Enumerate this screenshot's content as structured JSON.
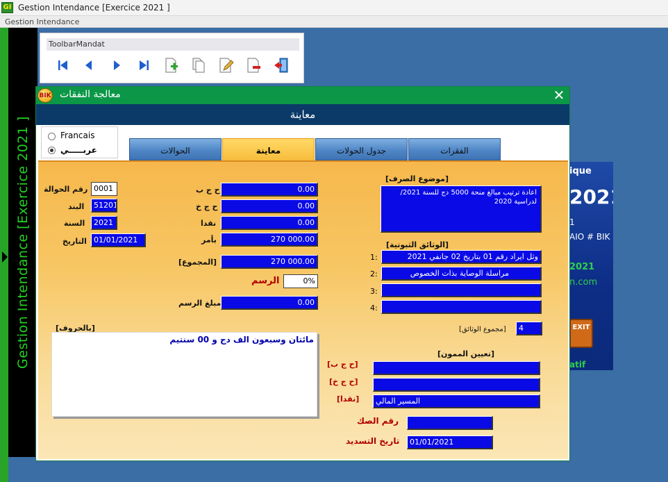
{
  "window": {
    "title": "Gestion Intendance [Exercice  2021 ]",
    "icon": "GI"
  },
  "menubar": {
    "item": "Gestion Intendance"
  },
  "sidebar": {
    "text": "Gestion Intendance [Exercice  2021 ]"
  },
  "toolbar": {
    "title": "ToolbarMandat",
    "buttons": [
      "first-icon",
      "prev-icon",
      "next-icon",
      "last-icon",
      "add-record-icon",
      "copy-record-icon",
      "edit-record-icon",
      "delete-record-icon",
      "exit-door-icon"
    ]
  },
  "background_banner": {
    "text1": "ique",
    "year": "2021",
    "line3": "1",
    "line4": "AIO # BIK",
    "green_year": "2021",
    "site": "n.com",
    "exit": "EXIT",
    "version": "atif Version"
  },
  "dialog": {
    "title": "معالجة النفقات",
    "logo": "BIK",
    "header": "معاينة",
    "language": {
      "option1": "Francais",
      "option2": "عربـــــي",
      "selected": "عربـــــي"
    },
    "tabs": [
      "الفقرات",
      "جدول الحولات",
      "معاينة",
      "الحوالات"
    ],
    "active_tab": "معاينة",
    "left": {
      "num_label": "رقم الحوالة",
      "num_value": "0001",
      "chapter_label": "البند",
      "chapter_value": "51201",
      "year_label": "السنة",
      "year_value": "2021",
      "date_label": "التاريخ",
      "date_value": "01/01/2021"
    },
    "middle": {
      "ccp_label": "ح ج ب",
      "ccp_value": "0.00",
      "ccq_label": "ح ج خ",
      "ccq_value": "0.00",
      "cash_label": "نقدا",
      "cash_value": "0.00",
      "order_label": "بأمر",
      "order_value": "270 000.00",
      "total_label": "[المجموع]",
      "total_value": "270 000.00",
      "tax_label": "الرسم",
      "tax_value": "0%",
      "tax_amount_label": "مبلغ الرسم",
      "tax_amount_value": "0.00"
    },
    "words_label": "[بالحروف]",
    "words_value": "مائتان وسبعون  الف دج و 00 سنتيم",
    "motif_label": "[موضوع الصرف]",
    "motif_value": "اعادة ترتيب مبالغ منحة 5000 دج للسنة 2021/ لدراسية 2020",
    "docs_label": "[الوثائق الثبوتية]",
    "docs": [
      {
        "num": "1:",
        "value": "وثل ايراد رقم 01 بتاريخ 02 جانفي 2021"
      },
      {
        "num": "2:",
        "value": "مراسلة الوصاية بذات الخصوص"
      },
      {
        "num": "3:",
        "value": ""
      },
      {
        "num": "4:",
        "value": ""
      }
    ],
    "docs_total_label": "[مجموع الوثائق]",
    "docs_total_value": "4",
    "supplier_label": "[تعيين الممون]",
    "supplier": {
      "ccp_label": "[ح ج ب]",
      "ccp_value": "",
      "ccq_label": "[ح ج خ]",
      "ccq_value": "",
      "cash_label": "[نقدا]",
      "cash_value": "المسير المالي"
    },
    "cheque_label": "رقم الصك",
    "cheque_value": "",
    "pay_date_label": "تاريخ التسديد",
    "pay_date_value": "01/01/2021"
  },
  "colors": {
    "desktop": "#3a6ea5",
    "title_green": "#0b9747",
    "header_navy": "#0b3a68",
    "field_blue": "#0a0ae6",
    "tab_active": "#f7bb3a"
  }
}
